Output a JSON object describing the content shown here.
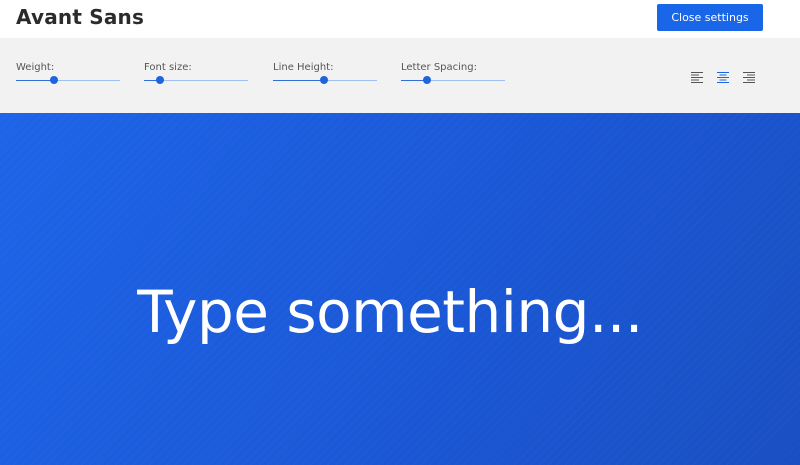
{
  "header": {
    "title": "Avant Sans",
    "close_label": "Close settings"
  },
  "settings": {
    "weight": {
      "label": "Weight:",
      "value": 0.37
    },
    "font_size": {
      "label": "Font size:",
      "value": 0.15
    },
    "line_height": {
      "label": "Line Height:",
      "value": 0.49
    },
    "letter_spacing": {
      "label": "Letter Spacing:",
      "value": 0.25
    },
    "alignment": {
      "options": [
        "align-left-icon",
        "align-center-icon",
        "align-right-icon"
      ],
      "selected": "center"
    }
  },
  "canvas": {
    "preview_text": "Type something..."
  },
  "colors": {
    "accent": "#1a66e8",
    "canvas_bg": "#1d5ee0",
    "settings_bg": "#f2f2f2",
    "icon_inactive": "#555555"
  }
}
